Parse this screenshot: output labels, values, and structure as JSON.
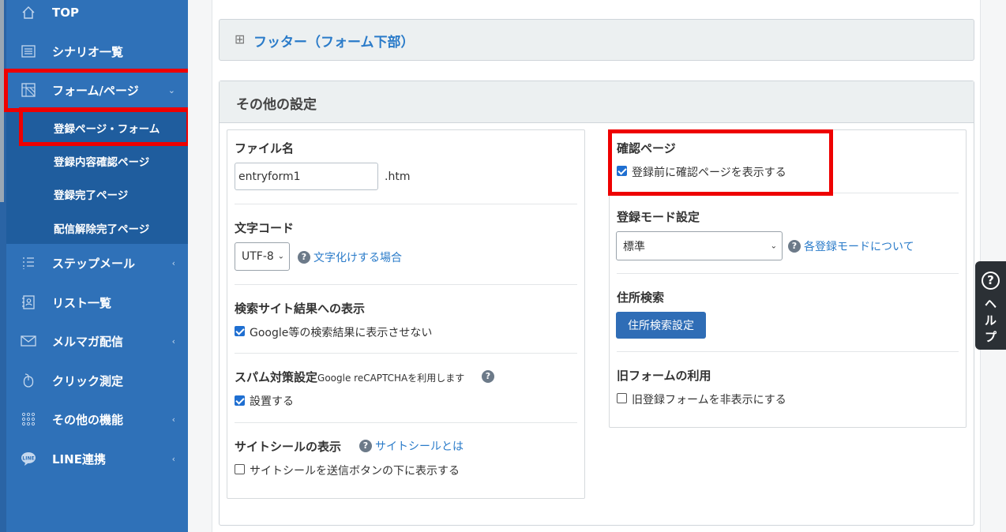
{
  "sidebar": {
    "items": [
      {
        "label": "TOP",
        "icon": "home-icon"
      },
      {
        "label": "シナリオ一覧",
        "icon": "list-icon"
      },
      {
        "label": "フォーム/ページ",
        "icon": "form-icon",
        "chevron": "⌄"
      },
      {
        "label": "ステップメール",
        "icon": "step-icon",
        "chevron": "‹"
      },
      {
        "label": "リスト一覧",
        "icon": "contacts-icon"
      },
      {
        "label": "メルマガ配信",
        "icon": "mail-icon",
        "chevron": "‹"
      },
      {
        "label": "クリック測定",
        "icon": "mouse-icon"
      },
      {
        "label": "その他の機能",
        "icon": "grid-icon",
        "chevron": "‹"
      },
      {
        "label": "LINE連携",
        "icon": "line-icon",
        "chevron": "‹"
      }
    ],
    "subitems": [
      {
        "label": "登録ページ・フォーム"
      },
      {
        "label": "登録内容確認ページ"
      },
      {
        "label": "登録完了ページ"
      },
      {
        "label": "配信解除完了ページ"
      }
    ]
  },
  "footer_panel": {
    "icon": "⊞",
    "title": "フッター（フォーム下部）"
  },
  "other_settings": {
    "title": "その他の設定",
    "left": {
      "file_name": {
        "label": "ファイル名",
        "value": "entryform1",
        "ext": ".htm"
      },
      "charset": {
        "label": "文字コード",
        "selected": "UTF-8",
        "help_link": "文字化けする場合"
      },
      "search_display": {
        "label": "検索サイト結果への表示",
        "checkbox_label": "Google等の検索結果に表示させない",
        "checked": true
      },
      "spam": {
        "label": "スパム対策設定",
        "sublabel": "Google reCAPTCHAを利用します",
        "checkbox_label": "設置する",
        "checked": true
      },
      "site_seal": {
        "label": "サイトシールの表示",
        "help_link": "サイトシールとは",
        "checkbox_label": "サイトシールを送信ボタンの下に表示する",
        "checked": false
      }
    },
    "right": {
      "confirm_page": {
        "label": "確認ページ",
        "checkbox_label": "登録前に確認ページを表示する",
        "checked": true
      },
      "mode": {
        "label": "登録モード設定",
        "selected": "標準",
        "help_link": "各登録モードについて"
      },
      "address": {
        "label": "住所検索",
        "button": "住所検索設定"
      },
      "old_form": {
        "label": "旧フォームの利用",
        "checkbox_label": "旧登録フォームを非表示にする",
        "checked": false
      }
    }
  },
  "help_tab": {
    "icon": "?",
    "chars": [
      "ヘ",
      "ル",
      "プ"
    ]
  },
  "colors": {
    "sidebar": "#2f71b8",
    "submenu": "#1f5d9e",
    "highlight": "#ee0000",
    "accent": "#2f6db6",
    "link": "#2a7bc9"
  }
}
